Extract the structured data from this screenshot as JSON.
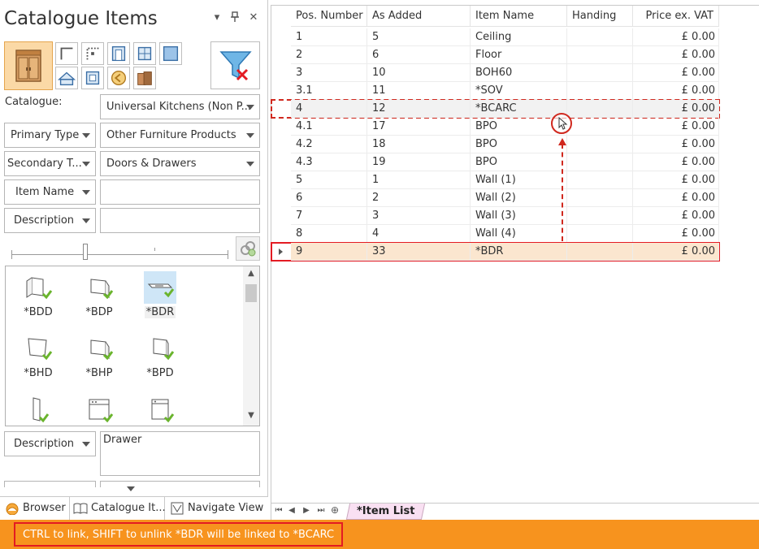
{
  "panel": {
    "title": "Catalogue Items",
    "controls": {
      "dropdown": "▾",
      "pin": "📌",
      "close": "✕"
    }
  },
  "filters": {
    "catalogue_label": "Catalogue:",
    "catalogue_value": "Universal Kitchens (Non P...",
    "primary_type_label": "Primary Type",
    "primary_type_value": "Other Furniture Products",
    "secondary_type_label": "Secondary T...",
    "secondary_type_value": "Doors & Drawers",
    "item_name_label": "Item Name",
    "item_name_value": "",
    "description_label": "Description",
    "description_value": ""
  },
  "gallery": {
    "items": [
      {
        "label": "*BDD",
        "selected": false
      },
      {
        "label": "*BDP",
        "selected": false
      },
      {
        "label": "*BDR",
        "selected": true
      },
      {
        "label": "*BHD",
        "selected": false
      },
      {
        "label": "*BHP",
        "selected": false
      },
      {
        "label": "*BPD",
        "selected": false
      },
      {
        "label": "",
        "selected": false
      },
      {
        "label": "",
        "selected": false
      },
      {
        "label": "",
        "selected": false
      }
    ]
  },
  "detail": {
    "description_label": "Description",
    "description_value": "Drawer"
  },
  "bottom_tabs": {
    "browser": "Browser",
    "catalogue_items": "Catalogue It...",
    "navigate_view": "Navigate View"
  },
  "grid": {
    "columns": [
      "Pos. Number",
      "As Added",
      "Item Name",
      "Handing",
      "Price ex. VAT"
    ],
    "rows": [
      {
        "pos": "1",
        "added": "5",
        "name": "Ceiling",
        "handing": "",
        "price": "£ 0.00"
      },
      {
        "pos": "2",
        "added": "6",
        "name": "Floor",
        "handing": "",
        "price": "£ 0.00"
      },
      {
        "pos": "3",
        "added": "10",
        "name": "BOH60",
        "handing": "",
        "price": "£ 0.00"
      },
      {
        "pos": "3.1",
        "added": "11",
        "name": "*SOV",
        "handing": "",
        "price": "£ 0.00"
      },
      {
        "pos": "4",
        "added": "12",
        "name": "*BCARC",
        "handing": "",
        "price": "£ 0.00"
      },
      {
        "pos": "4.1",
        "added": "17",
        "name": "BPO",
        "handing": "",
        "price": "£ 0.00"
      },
      {
        "pos": "4.2",
        "added": "18",
        "name": "BPO",
        "handing": "",
        "price": "£ 0.00"
      },
      {
        "pos": "4.3",
        "added": "19",
        "name": "BPO",
        "handing": "",
        "price": "£ 0.00"
      },
      {
        "pos": "5",
        "added": "1",
        "name": "Wall (1)",
        "handing": "",
        "price": "£ 0.00"
      },
      {
        "pos": "6",
        "added": "2",
        "name": "Wall (2)",
        "handing": "",
        "price": "£ 0.00"
      },
      {
        "pos": "7",
        "added": "3",
        "name": "Wall (3)",
        "handing": "",
        "price": "£ 0.00"
      },
      {
        "pos": "8",
        "added": "4",
        "name": "Wall (4)",
        "handing": "",
        "price": "£ 0.00"
      },
      {
        "pos": "9",
        "added": "33",
        "name": "*BDR",
        "handing": "",
        "price": "£ 0.00"
      }
    ],
    "drag_target_row": 4,
    "current_row": 12
  },
  "sheets": {
    "nav": {
      "first": "⏮",
      "prev": "◀",
      "next": "▶",
      "last": "⏭",
      "add": "⊕"
    },
    "active_tab": "*Item List"
  },
  "status": {
    "message": "CTRL to link, SHIFT to unlink *BDR will be linked to *BCARC"
  },
  "colors": {
    "accent": "#f7931e",
    "highlight": "#e31b23",
    "selected_row_bg": "#fbe6cf",
    "sheet_tab_bg": "#f9e0f2"
  }
}
